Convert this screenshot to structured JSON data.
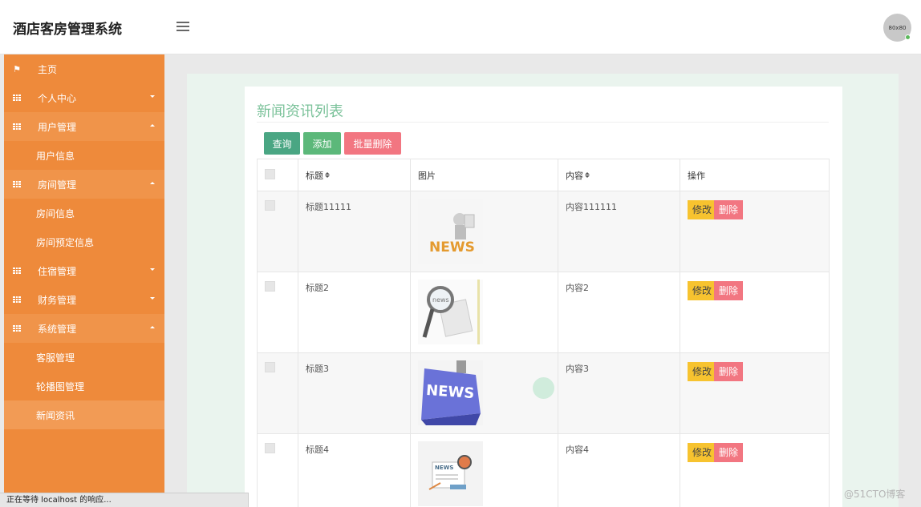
{
  "app": {
    "title": "酒店客房管理系统",
    "avatar_text": "80x80"
  },
  "sidebar": {
    "items": [
      {
        "label": "主页",
        "icon": "flag-icon"
      },
      {
        "label": "个人中心",
        "icon": "grid-icon",
        "expanded": false
      },
      {
        "label": "用户管理",
        "icon": "grid-icon",
        "expanded": true,
        "children": [
          "用户信息"
        ]
      },
      {
        "label": "房间管理",
        "icon": "grid-icon",
        "expanded": true,
        "children": [
          "房间信息",
          "房间预定信息"
        ]
      },
      {
        "label": "住宿管理",
        "icon": "grid-icon",
        "expanded": false
      },
      {
        "label": "财务管理",
        "icon": "grid-icon",
        "expanded": false
      },
      {
        "label": "系统管理",
        "icon": "grid-icon",
        "expanded": true,
        "children": [
          "客服管理",
          "轮播图管理",
          "新闻资讯"
        ]
      }
    ],
    "active": "新闻资讯"
  },
  "panel": {
    "title": "新闻资讯列表",
    "buttons": {
      "search": "查询",
      "add": "添加",
      "batch_delete": "批量删除"
    }
  },
  "table": {
    "headers": {
      "title": "标题",
      "image": "图片",
      "content": "内容",
      "actions": "操作"
    },
    "rows": [
      {
        "title": "标题11111",
        "content": "内容111111",
        "image": "news-3d-figure"
      },
      {
        "title": "标题2",
        "content": "内容2",
        "image": "news-magnifier"
      },
      {
        "title": "标题3",
        "content": "内容3",
        "image": "news-keyboard-key"
      },
      {
        "title": "标题4",
        "content": "内容4",
        "image": "news-paper-illustration"
      }
    ],
    "row_actions": {
      "edit": "修改",
      "delete": "删除"
    }
  },
  "status_bar": {
    "text": "正在等待 localhost 的响应..."
  },
  "watermark": "@51CTO博客",
  "colors": {
    "sidebar": "#ee8a3b",
    "title": "#7bc29a",
    "edit": "#f7c32f",
    "delete": "#f27681",
    "search": "#4aa683",
    "add": "#5cb87a"
  }
}
